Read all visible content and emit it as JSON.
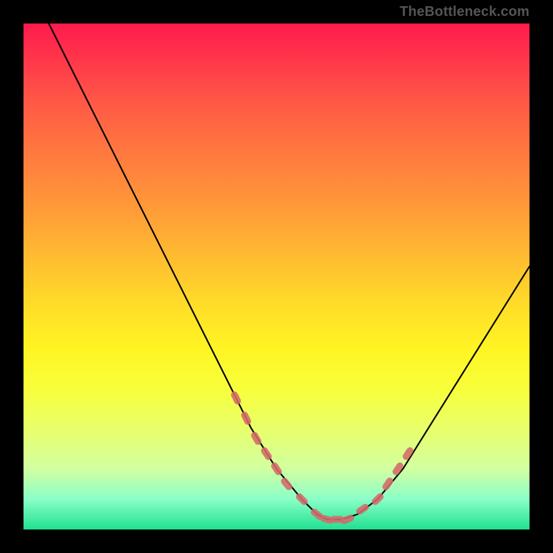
{
  "attribution": "TheBottleneck.com",
  "colors": {
    "page_bg": "#000000",
    "gradient_top": "#ff1a4d",
    "gradient_mid": "#ffde28",
    "gradient_bottom": "#20e090",
    "curve_stroke": "#000000",
    "marker_fill": "#d46a6a"
  },
  "chart_data": {
    "type": "line",
    "title": "",
    "xlabel": "",
    "ylabel": "",
    "xlim": [
      0,
      100
    ],
    "ylim": [
      0,
      100
    ],
    "grid": false,
    "legend": false,
    "series": [
      {
        "name": "bottleneck-curve",
        "x": [
          0,
          5,
          10,
          15,
          20,
          25,
          30,
          35,
          40,
          45,
          50,
          55,
          58,
          60,
          63,
          66,
          70,
          75,
          80,
          85,
          90,
          95,
          100
        ],
        "values": [
          110,
          100,
          90,
          80,
          70,
          60,
          50,
          40,
          30,
          20,
          12,
          6,
          3,
          2,
          2,
          3,
          6,
          12,
          20,
          28,
          36,
          44,
          52
        ]
      }
    ],
    "markers": {
      "name": "highlighted-range",
      "x": [
        42,
        44,
        46,
        48,
        50,
        52,
        55,
        58,
        60,
        62,
        64,
        67,
        70,
        72,
        74,
        76
      ],
      "values": [
        26,
        22,
        18,
        15,
        12,
        9,
        6,
        3,
        2,
        2,
        2,
        4,
        6,
        9,
        12,
        15
      ]
    }
  }
}
